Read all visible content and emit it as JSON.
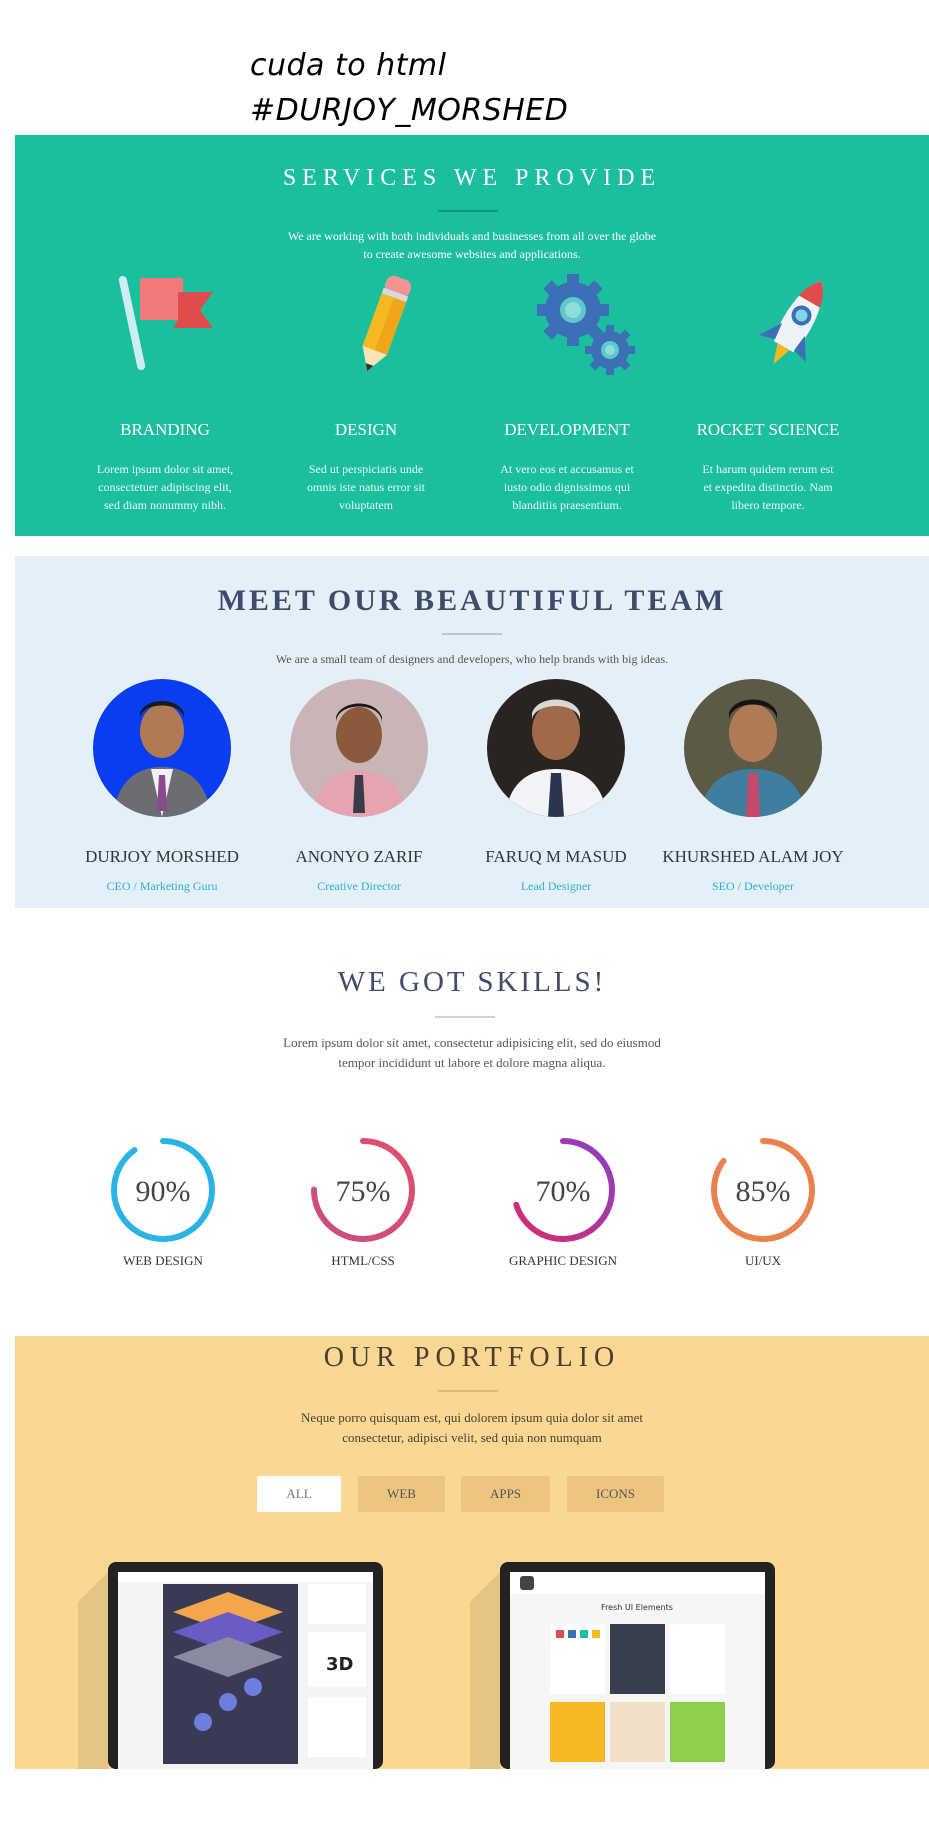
{
  "header": {
    "line1": "cuda to html",
    "line2": "#DURJOY_MORSHED"
  },
  "services": {
    "title": "SERVICES WE PROVIDE",
    "subtitle_line1": "We are working with both individuals and businesses from all over the globe",
    "subtitle_line2": "to create awesome websites and applications.",
    "items": [
      {
        "icon": "flag-icon",
        "title": "BRANDING",
        "text": [
          "Lorem ipsum dolor sit amet,",
          "consectetuer adipiscing elit,",
          "sed diam nonummy nibh."
        ]
      },
      {
        "icon": "pencil-icon",
        "title": "DESIGN",
        "text": [
          "Sed ut perspiciatis unde",
          "omnis iste natus error sit",
          "voluptatem"
        ]
      },
      {
        "icon": "gears-icon",
        "title": "DEVELOPMENT",
        "text": [
          "At vero eos et accusamus et",
          "iusto odio dignissimos qui",
          "blanditiis praesentium."
        ]
      },
      {
        "icon": "rocket-icon",
        "title": "ROCKET SCIENCE",
        "text": [
          "Et harum quidem rerum est",
          "et expedita distinctio. Nam",
          "libero tempore."
        ]
      }
    ]
  },
  "team": {
    "title": "MEET OUR BEAUTIFUL TEAM",
    "subtitle": "We are a small team of designers and developers, who help brands with big ideas.",
    "members": [
      {
        "name": "DURJOY MORSHED",
        "role": "CEO / Marketing Guru",
        "bg": "#0a3cf0"
      },
      {
        "name": "ANONYO ZARIF",
        "role": "Creative Director",
        "bg": "#b8a8a8"
      },
      {
        "name": "FARUQ M MASUD",
        "role": "Lead Designer",
        "bg": "#2a2420"
      },
      {
        "name": "KHURSHED ALAM JOY",
        "role": "SEO / Developer",
        "bg": "#5a5a40"
      }
    ]
  },
  "skills": {
    "title": "WE GOT SKILLS!",
    "subtitle_line1": "Lorem ipsum dolor sit amet, consectetur adipisicing elit, sed do eiusmod",
    "subtitle_line2": "tempor incididunt ut labore et dolore magna aliqua.",
    "items": [
      {
        "value": "90%",
        "percent": 90,
        "label": "WEB DESIGN",
        "color1": "#2bb4e3",
        "color2": "#2bb4e3"
      },
      {
        "value": "75%",
        "percent": 75,
        "label": "HTML/CSS",
        "color1": "#c94d7f",
        "color2": "#e04f6c"
      },
      {
        "value": "70%",
        "percent": 70,
        "label": "GRAPHIC DESIGN",
        "color1": "#d42e6e",
        "color2": "#8c3fc4"
      },
      {
        "value": "85%",
        "percent": 85,
        "label": "UI/UX",
        "color1": "#e8824f",
        "color2": "#e8824f"
      }
    ]
  },
  "portfolio": {
    "title": "OUR PORTFOLIO",
    "subtitle_line1": "Neque porro quisquam est, qui dolorem ipsum quia dolor sit amet",
    "subtitle_line2": "consectetur, adipisci velit, sed quia non numquam",
    "filters": [
      "ALL",
      "WEB",
      "APPS",
      "ICONS"
    ],
    "laptop2_heading": "Fresh UI Elements"
  },
  "colors": {
    "services_bg": "#1bbf9e",
    "team_bg": "#e5eff8",
    "portfolio_bg": "#fbd794",
    "accent_blue": "#2ab0d8"
  }
}
